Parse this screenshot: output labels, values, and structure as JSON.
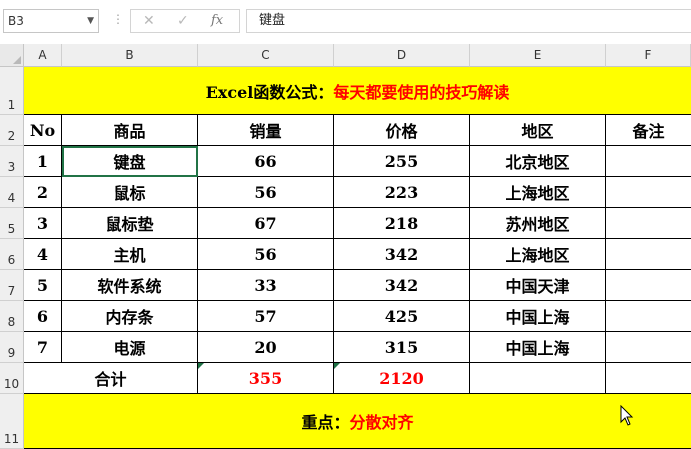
{
  "formula_bar": {
    "name_box": "B3",
    "cancel_icon": "✕",
    "enter_icon": "✓",
    "fx_label": "fx",
    "formula": "键盘"
  },
  "columns": [
    "A",
    "B",
    "C",
    "D",
    "E",
    "F"
  ],
  "rows": [
    "1",
    "2",
    "3",
    "4",
    "5",
    "6",
    "7",
    "8",
    "9",
    "10",
    "11"
  ],
  "sheet": {
    "title_black": "Excel函数公式：",
    "title_red": "每天都要使用的技巧解读",
    "headers": [
      "No",
      "商品",
      "销量",
      "价格",
      "地区",
      "备注"
    ],
    "data": [
      [
        "1",
        "键盘",
        "66",
        "255",
        "北京地区",
        ""
      ],
      [
        "2",
        "鼠标",
        "56",
        "223",
        "上海地区",
        ""
      ],
      [
        "3",
        "鼠标垫",
        "67",
        "218",
        "苏州地区",
        ""
      ],
      [
        "4",
        "主机",
        "56",
        "342",
        "上海地区",
        ""
      ],
      [
        "5",
        "软件系统",
        "33",
        "342",
        "中国天津",
        ""
      ],
      [
        "6",
        "内存条",
        "57",
        "425",
        "中国上海",
        ""
      ],
      [
        "7",
        "电源",
        "20",
        "315",
        "中国上海",
        ""
      ]
    ],
    "total_label": "合计",
    "total_sales": "355",
    "total_price": "2120",
    "footer_black": "重点：",
    "footer_red": "分散对齐"
  },
  "colors": {
    "highlight": "#ffff00",
    "accent_red": "#ff0000",
    "excel_green": "#1e7145"
  }
}
